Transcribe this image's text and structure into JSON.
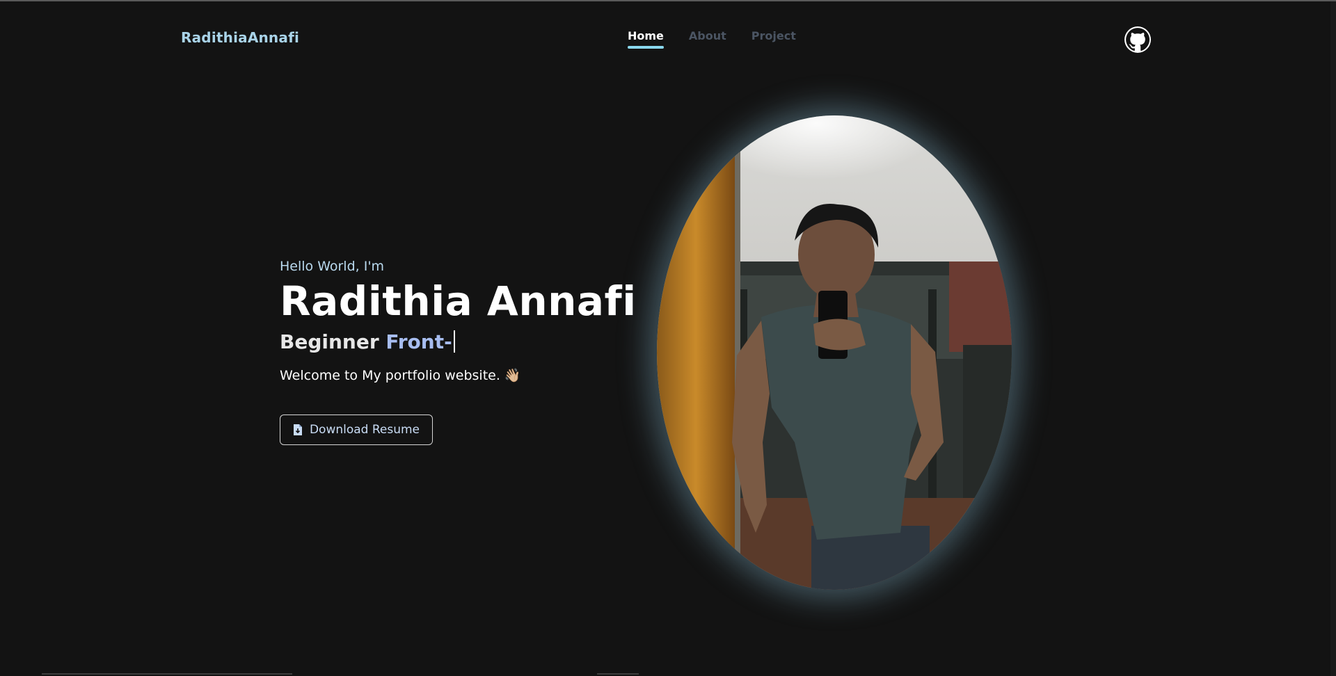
{
  "header": {
    "brand": "RadithiaAnnafi",
    "nav": [
      {
        "label": "Home",
        "active": true
      },
      {
        "label": "About",
        "active": false
      },
      {
        "label": "Project",
        "active": false
      }
    ],
    "github_icon": "github-icon"
  },
  "hero": {
    "greeting": "Hello World, I'm",
    "name": "Radithia Annafi",
    "role_prefix": "Beginner ",
    "role_typed": "Front-",
    "welcome": "Welcome to My portfolio website. 👋🏼",
    "resume_button": "Download Resume",
    "resume_icon": "file-download-icon"
  },
  "colors": {
    "background": "#131313",
    "brand": "#a9d3e8",
    "accent": "#8ad8ee",
    "nav_inactive": "#4b5563",
    "typed_role": "#a7bdf0"
  }
}
